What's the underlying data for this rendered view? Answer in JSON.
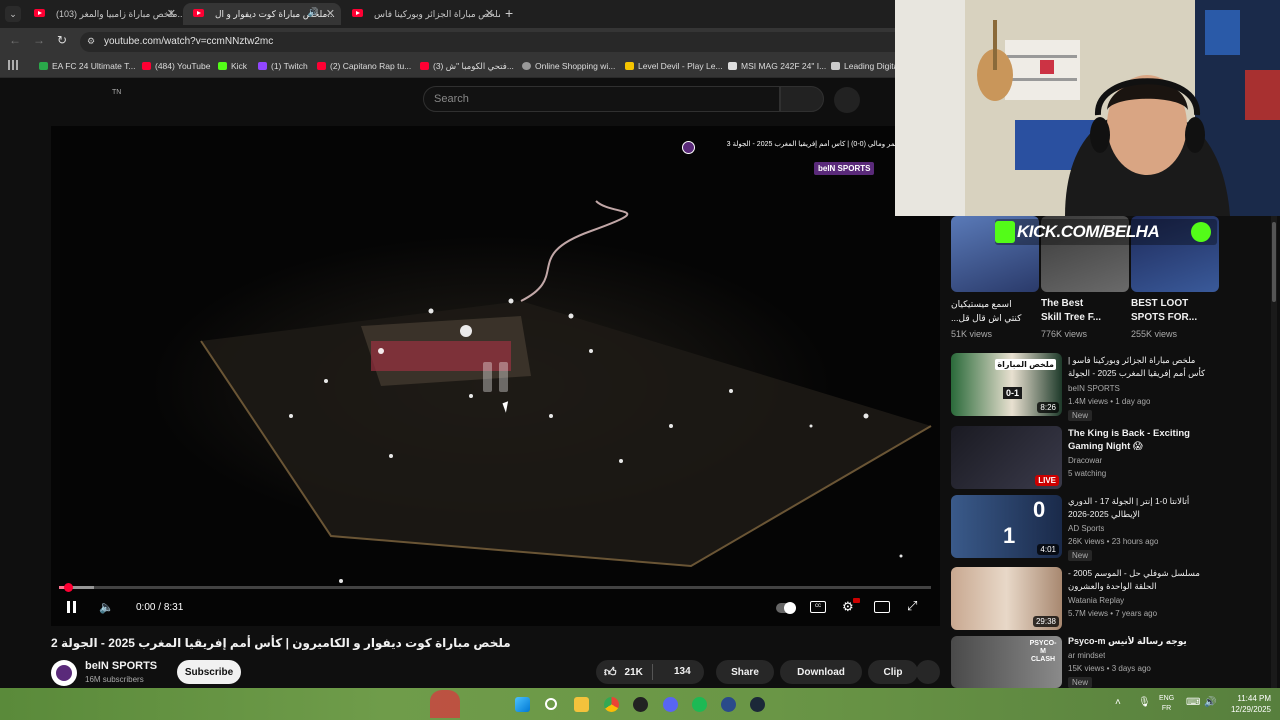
{
  "browser": {
    "tabs": [
      {
        "label": "(103) ملخص مباراة زامبيا والمغر...",
        "active": false
      },
      {
        "label": "ملخص مباراة كوت ديفوار و ال...",
        "active": true
      },
      {
        "label": "ملخص مباراة الجزائر وبوركينا فاس...",
        "active": false
      }
    ],
    "url": "youtube.com/watch?v=ccmNNztw2mc",
    "bookmarks": [
      "EA FC 24 Ultimate T...",
      "(484) YouTube",
      "Kick",
      "(1) Twitch",
      "(2) Capitano Rap tu...",
      "(3) فتحي الكومبا \"ش...",
      "Online Shopping wi...",
      "Level Devil - Play Le...",
      "MSI MAG 242F 24\" I...",
      "Leading Digita..."
    ]
  },
  "youtube": {
    "country_code": "TN",
    "search_placeholder": "Search"
  },
  "player": {
    "overlay_title": "مباراة جزر القمر ومالي (0-0) | كأس أمم إفريقيا المغرب 2025 - الجولة 3",
    "watermark": "beIN SPORTS",
    "time_current": "0:00",
    "time_separator": "/",
    "time_total": "8:31",
    "progress": 0.01
  },
  "video": {
    "title": "ملخص مباراة كوت ديفوار و الكاميرون | كأس أمم إفريقيا المغرب 2025 - الجولة 2",
    "channel": "beIN SPORTS",
    "subscribers": "16M subscribers",
    "subscribe_label": "Subscribe",
    "likes": "21K",
    "comments": "134",
    "share_label": "Share",
    "download_label": "Download",
    "clip_label": "Clip"
  },
  "overlay_banner": "KICK.COM/BELHA",
  "shorts": [
    {
      "title_line1": "اسمع ميستيكيان",
      "title_line2": "كنتي اش قال قل...",
      "views": "51K views"
    },
    {
      "title_line1": "The Best",
      "title_line2": "Skill Tree F...",
      "views": "776K views"
    },
    {
      "title_line1": "BEST LOOT",
      "title_line2": "SPOTS FOR...",
      "views": "255K views"
    }
  ],
  "sidebar_videos": [
    {
      "title": "ملخص مباراة الجزائر وبوركينا فاسو | كأس أمم إفريقيا المغرب 2025 - الجولة 2",
      "channel": "beIN SPORTS",
      "meta": "1.4M views • 1 day ago",
      "duration": "8:26",
      "badge": "New",
      "thumb_text": "ملخص المباراة",
      "score": "0-1"
    },
    {
      "title": "The King is Back - Exciting Gaming Night 😱",
      "channel": "Dracowar",
      "meta": "5 watching",
      "duration": "LIVE",
      "badge": ""
    },
    {
      "title": "أتالانتا 0-1 إنتر | الجولة 17 - الدوري الإيطالي 2025-2026",
      "channel": "AD Sports",
      "meta": "26K views • 23 hours ago",
      "duration": "4:01",
      "badge": "New",
      "score_top": "0",
      "score_bottom": "1"
    },
    {
      "title": "مسلسل شوفلي حل - الموسم 2005 - الحلقة الواحدة والعشرون",
      "channel": "Watania Replay",
      "meta": "5.7M views • 7 years ago",
      "duration": "29:38",
      "badge": ""
    },
    {
      "title": "Psyco-m يوجه رسالة لأنيس",
      "channel": "ar mindset",
      "meta": "15K views • 3 days ago",
      "duration": "",
      "badge": "New",
      "thumb_text": "PSYCO-M CLASH"
    }
  ],
  "taskbar": {
    "lang_top": "ENG",
    "lang_bottom": "FR",
    "time": "11:44 PM",
    "date": "12/29/2025"
  },
  "colors": {
    "youtube_red": "#ff0033",
    "accent_blue": "#3ea6ff",
    "kick_green": "#53fc18",
    "live_red": "#cc0000"
  }
}
